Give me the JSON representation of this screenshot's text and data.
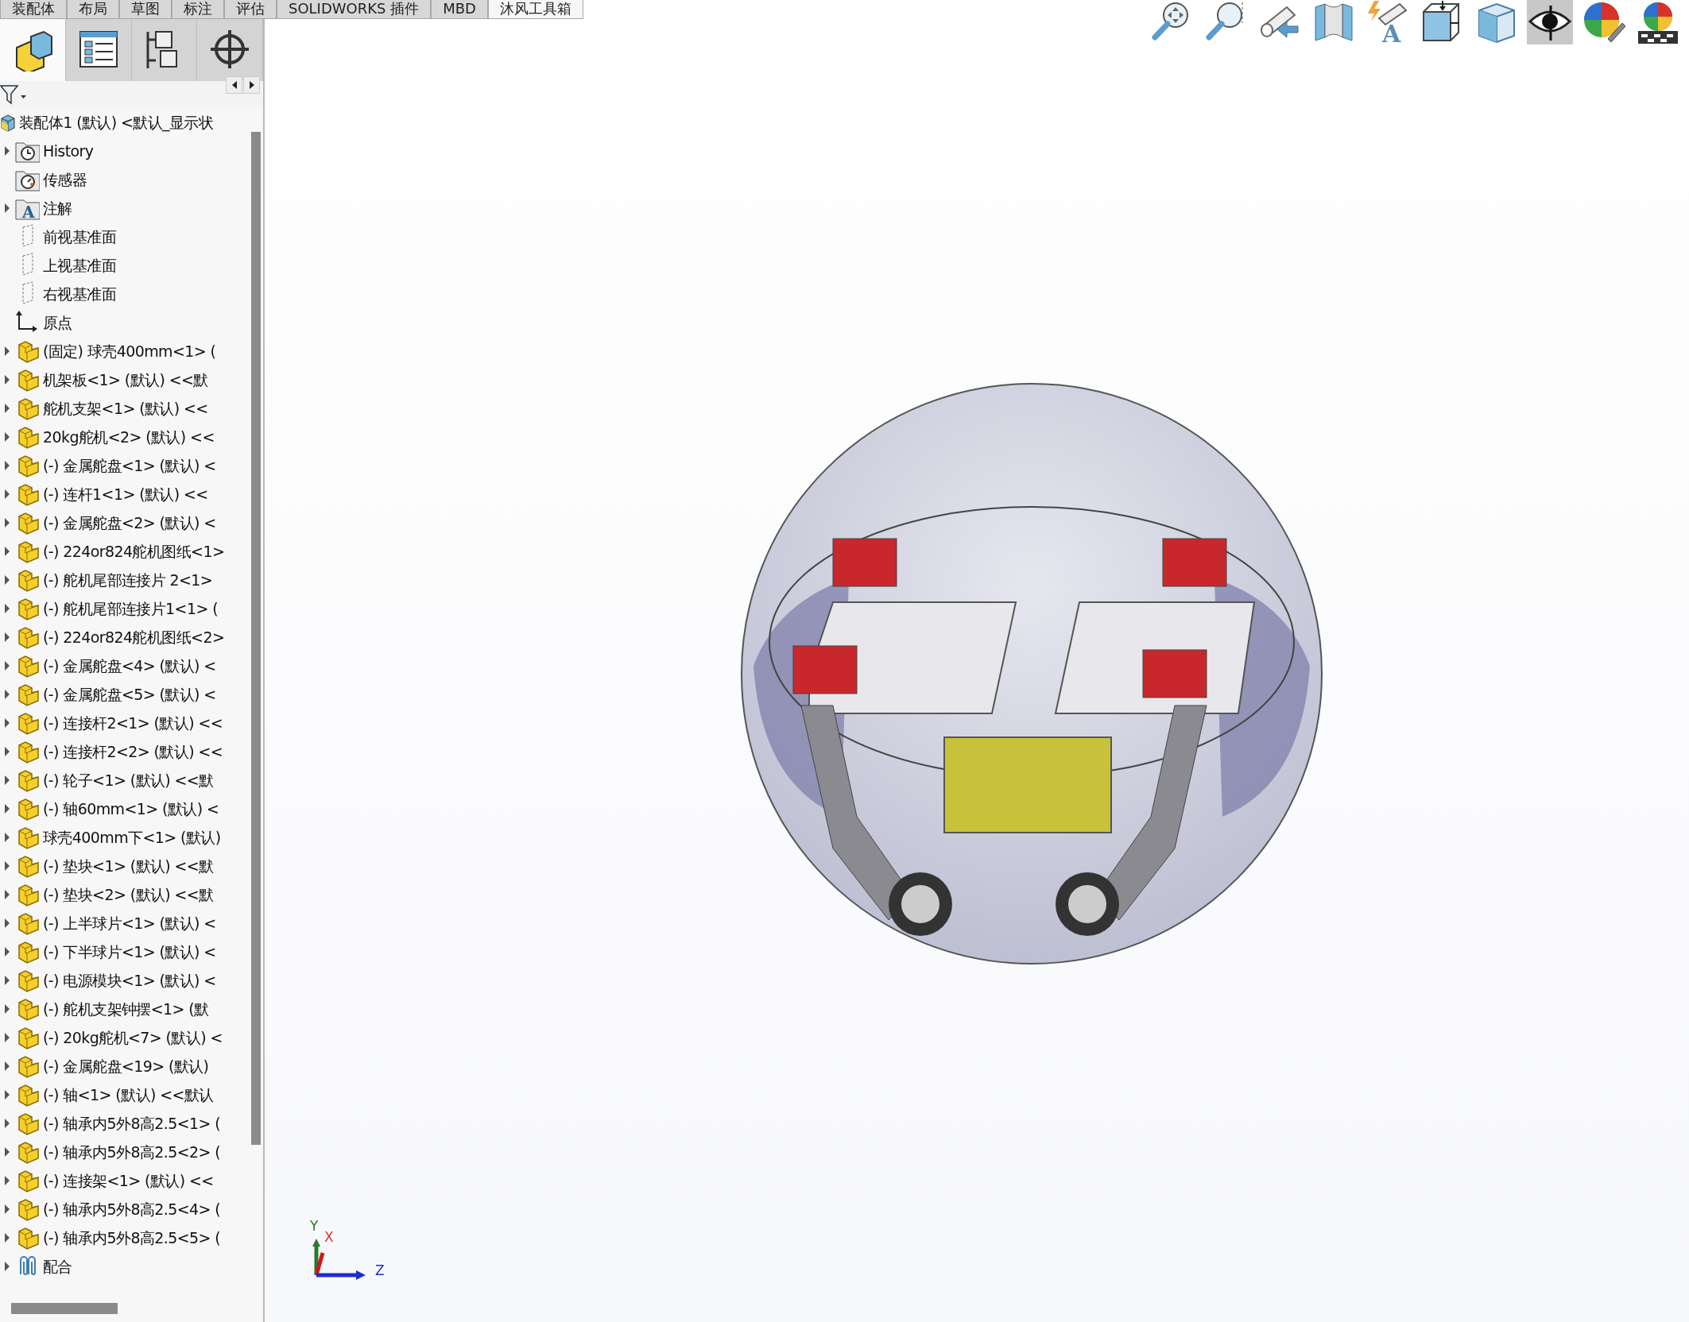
{
  "command_tabs": [
    {
      "label": "装配体",
      "selected": false
    },
    {
      "label": "布局",
      "selected": false
    },
    {
      "label": "草图",
      "selected": false
    },
    {
      "label": "标注",
      "selected": false
    },
    {
      "label": "评估",
      "selected": false
    },
    {
      "label": "SOLIDWORKS 插件",
      "selected": false
    },
    {
      "label": "MBD",
      "selected": false
    },
    {
      "label": "沐风工具箱",
      "selected": true
    }
  ],
  "panel_tabs": [
    {
      "kind": "feature-tree",
      "selected": true
    },
    {
      "kind": "property",
      "selected": false
    },
    {
      "kind": "config",
      "selected": false
    },
    {
      "kind": "dimxpert",
      "selected": false
    }
  ],
  "tree": {
    "root": "装配体1 (默认) <默认_显示状",
    "items": [
      {
        "kind": "history",
        "label": "History",
        "expanded": false
      },
      {
        "kind": "sensor",
        "label": "传感器"
      },
      {
        "kind": "annotation",
        "label": "注解",
        "icon_text": "A",
        "expanded": false
      },
      {
        "kind": "plane",
        "label": "前视基准面"
      },
      {
        "kind": "plane",
        "label": "上视基准面"
      },
      {
        "kind": "plane",
        "label": "右视基准面"
      },
      {
        "kind": "origin",
        "label": "原点"
      },
      {
        "kind": "part",
        "label": "(固定) 球壳400mm<1> (",
        "expanded": false
      },
      {
        "kind": "part",
        "label": "机架板<1> (默认) <<默",
        "expanded": false
      },
      {
        "kind": "part",
        "label": "舵机支架<1> (默认) <<",
        "expanded": false
      },
      {
        "kind": "part",
        "label": "20kg舵机<2> (默认) <<",
        "expanded": false
      },
      {
        "kind": "part",
        "label": "(-) 金属舵盘<1> (默认) <",
        "expanded": false
      },
      {
        "kind": "part",
        "label": "(-) 连杆1<1> (默认) <<",
        "expanded": false
      },
      {
        "kind": "part",
        "label": "(-) 金属舵盘<2> (默认) <",
        "expanded": false
      },
      {
        "kind": "part",
        "label": "(-) 224or824舵机图纸<1>",
        "expanded": false
      },
      {
        "kind": "part",
        "label": "(-) 舵机尾部连接片 2<1>",
        "expanded": false
      },
      {
        "kind": "part",
        "label": "(-) 舵机尾部连接片1<1> (",
        "expanded": false
      },
      {
        "kind": "part",
        "label": "(-) 224or824舵机图纸<2>",
        "expanded": false
      },
      {
        "kind": "part",
        "label": "(-) 金属舵盘<4> (默认) <",
        "expanded": false
      },
      {
        "kind": "part",
        "label": "(-) 金属舵盘<5> (默认) <",
        "expanded": false
      },
      {
        "kind": "part",
        "label": "(-) 连接杆2<1> (默认) <<",
        "expanded": false
      },
      {
        "kind": "part",
        "label": "(-) 连接杆2<2> (默认) <<",
        "expanded": false
      },
      {
        "kind": "part",
        "label": "(-) 轮子<1> (默认) <<默",
        "expanded": false
      },
      {
        "kind": "part",
        "label": "(-) 轴60mm<1> (默认) <",
        "expanded": false
      },
      {
        "kind": "part",
        "label": "球壳400mm下<1> (默认)",
        "expanded": false
      },
      {
        "kind": "part",
        "label": "(-) 垫块<1> (默认) <<默",
        "expanded": false
      },
      {
        "kind": "part",
        "label": "(-) 垫块<2> (默认) <<默",
        "expanded": false
      },
      {
        "kind": "part",
        "label": "(-) 上半球片<1> (默认) <",
        "expanded": false
      },
      {
        "kind": "part",
        "label": "(-) 下半球片<1> (默认) <",
        "expanded": false
      },
      {
        "kind": "part",
        "label": "(-) 电源模块<1> (默认) <",
        "expanded": false
      },
      {
        "kind": "part",
        "label": "(-) 舵机支架钟摆<1> (默",
        "expanded": false
      },
      {
        "kind": "part",
        "label": "(-) 20kg舵机<7> (默认) <",
        "expanded": false
      },
      {
        "kind": "part",
        "label": "(-) 金属舵盘<19> (默认)",
        "expanded": false
      },
      {
        "kind": "part",
        "label": "(-) 轴<1> (默认) <<默认",
        "expanded": false
      },
      {
        "kind": "part",
        "label": "(-) 轴承内5外8高2.5<1> (",
        "expanded": false
      },
      {
        "kind": "part",
        "label": "(-) 轴承内5外8高2.5<2> (",
        "expanded": false
      },
      {
        "kind": "part",
        "label": "(-) 连接架<1> (默认) <<",
        "expanded": false
      },
      {
        "kind": "part",
        "label": "(-) 轴承内5外8高2.5<4> (",
        "expanded": false
      },
      {
        "kind": "part",
        "label": "(-) 轴承内5外8高2.5<5> (",
        "expanded": false
      },
      {
        "kind": "mates",
        "label": "配合",
        "expanded": false
      }
    ]
  },
  "view_toolbar": [
    {
      "kind": "zoom-fit"
    },
    {
      "kind": "zoom-area"
    },
    {
      "kind": "previous-view"
    },
    {
      "kind": "section"
    },
    {
      "kind": "annotation-view",
      "icon_text": "A"
    },
    {
      "kind": "orientation"
    },
    {
      "kind": "display-style"
    },
    {
      "kind": "hide-show"
    },
    {
      "kind": "appearance"
    },
    {
      "kind": "scene"
    }
  ],
  "triad": {
    "y": "Y",
    "x": "X",
    "z": "Z"
  }
}
